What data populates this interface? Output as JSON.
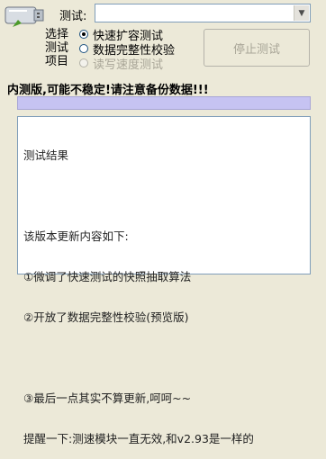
{
  "header": {
    "test_label": "测试:"
  },
  "side_label": [
    "选择",
    "测试",
    "项目"
  ],
  "options": [
    {
      "label": "快速扩容测试",
      "selected": true,
      "disabled": false
    },
    {
      "label": "数据完整性校验",
      "selected": false,
      "disabled": false
    },
    {
      "label": "读写速度测试",
      "selected": false,
      "disabled": true
    }
  ],
  "buttons": {
    "stop": "停止测试"
  },
  "warning": "内测版,可能不稳定!请注意备份数据!!!",
  "results_lines": [
    "测试结果",
    "",
    "该版本更新内容如下:",
    "①微调了快速测试的快照抽取算法",
    "②开放了数据完整性校验(预览版)",
    "",
    "③最后一点其实不算更新,呵呵~~",
    "提醒一下:测速模块一直无效,和v2.93是一样的"
  ],
  "icons": {
    "logo": "usb-disk-icon",
    "dropdown": "chevron-down-icon"
  }
}
